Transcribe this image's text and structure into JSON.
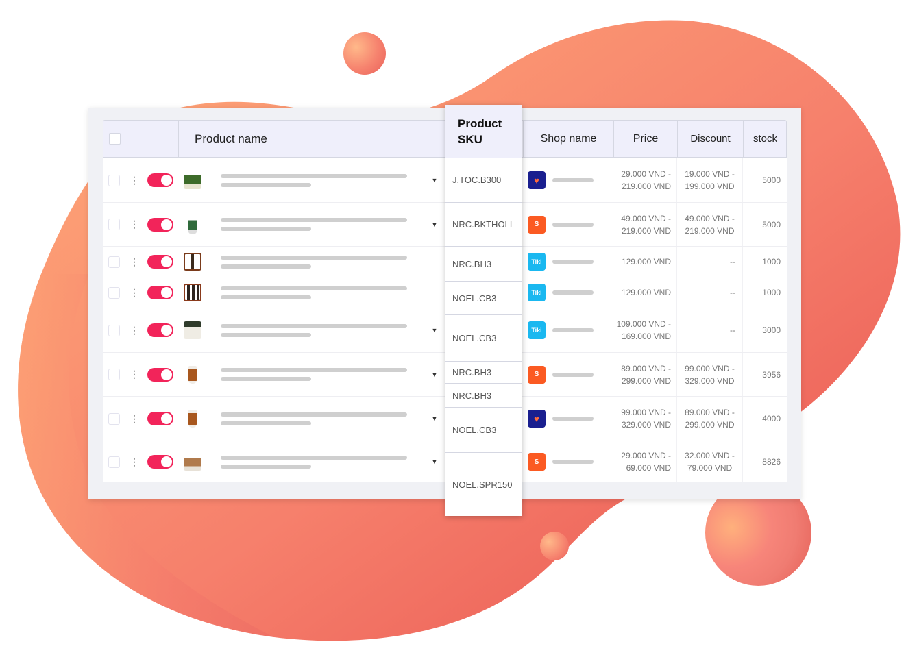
{
  "colors": {
    "accent_toggle": "#f2245a",
    "blob_start": "#ffa877",
    "blob_end": "#ec5c56",
    "lazada": "#1a1f8f",
    "shopee": "#fb5a22",
    "tiki": "#1ab8f0"
  },
  "table": {
    "headers": {
      "product_name": "Product name",
      "product_sku": "Product SKU",
      "shop_name": "Shop name",
      "price": "Price",
      "discount": "Discount",
      "stock": "stock"
    },
    "rows": [
      {
        "thumb": "bottles3",
        "has_caret": true,
        "sku": "J.TOC.B300",
        "shop": "lazada",
        "shop_icon": "lazada-logo-icon",
        "price": "29.000 VND - 219.000 VND",
        "discount": "19.000 VND - 199.000 VND",
        "stock": "5000",
        "enabled": true
      },
      {
        "thumb": "bottle1",
        "has_caret": true,
        "sku": "NRC.BKTHOLI",
        "shop": "shopee",
        "shop_icon": "shopee-logo-icon",
        "price": "49.000 VND - 219.000 VND",
        "discount": "49.000 VND - 219.000 VND",
        "stock": "5000",
        "enabled": true
      },
      {
        "thumb": "frame1",
        "has_caret": false,
        "sku": "NRC.BH3",
        "shop": "tiki",
        "shop_icon": "tiki-logo-icon",
        "price": "129.000 VND",
        "discount": "--",
        "stock": "1000",
        "enabled": true
      },
      {
        "thumb": "frame3",
        "has_caret": false,
        "sku": "NOEL.CB3",
        "shop": "tiki",
        "shop_icon": "tiki-logo-icon",
        "price": "129.000 VND",
        "discount": "--",
        "stock": "1000",
        "enabled": true
      },
      {
        "thumb": "box",
        "has_caret": true,
        "sku": "NOEL.CB3",
        "shop": "tiki",
        "shop_icon": "tiki-logo-icon",
        "price": "109.000 VND - 169.000 VND",
        "discount": "--",
        "stock": "3000",
        "enabled": true
      },
      {
        "thumb": "cup",
        "has_caret": true,
        "sku": "NRC.BH3",
        "shop": "shopee",
        "shop_icon": "shopee-logo-icon",
        "price": "89.000 VND - 299.000 VND",
        "discount": "99.000 VND - 329.000 VND",
        "stock": "3956",
        "enabled": true
      },
      {
        "thumb": "cup",
        "has_caret": true,
        "sku": "NOEL.CB3",
        "shop": "lazada",
        "shop_icon": "lazada-logo-icon",
        "price": "99.000 VND - 329.000 VND",
        "discount": "89.000 VND - 299.000 VND",
        "stock": "4000",
        "enabled": true
      },
      {
        "thumb": "bottles5",
        "has_caret": true,
        "sku": "NOEL.SPR150",
        "shop": "shopee",
        "shop_icon": "shopee-logo-icon",
        "price": "29.000 VND - 69.000 VND",
        "discount": "32.000 VND - 79.000 VND",
        "stock": "8826",
        "enabled": true
      }
    ],
    "sku_column": [
      "J.TOC.B300",
      "NRC.BKTHOLI",
      "NRC.BH3",
      "NOEL.CB3",
      "NOEL.CB3",
      "NRC.BH3",
      "NRC.BH3",
      "NOEL.CB3",
      "NOEL.SPR150"
    ],
    "shop_labels": {
      "lazada": "♥",
      "shopee": "S",
      "tiki": "Tiki"
    },
    "more_icon_glyph": "⋮",
    "caret_glyph": "▼"
  }
}
